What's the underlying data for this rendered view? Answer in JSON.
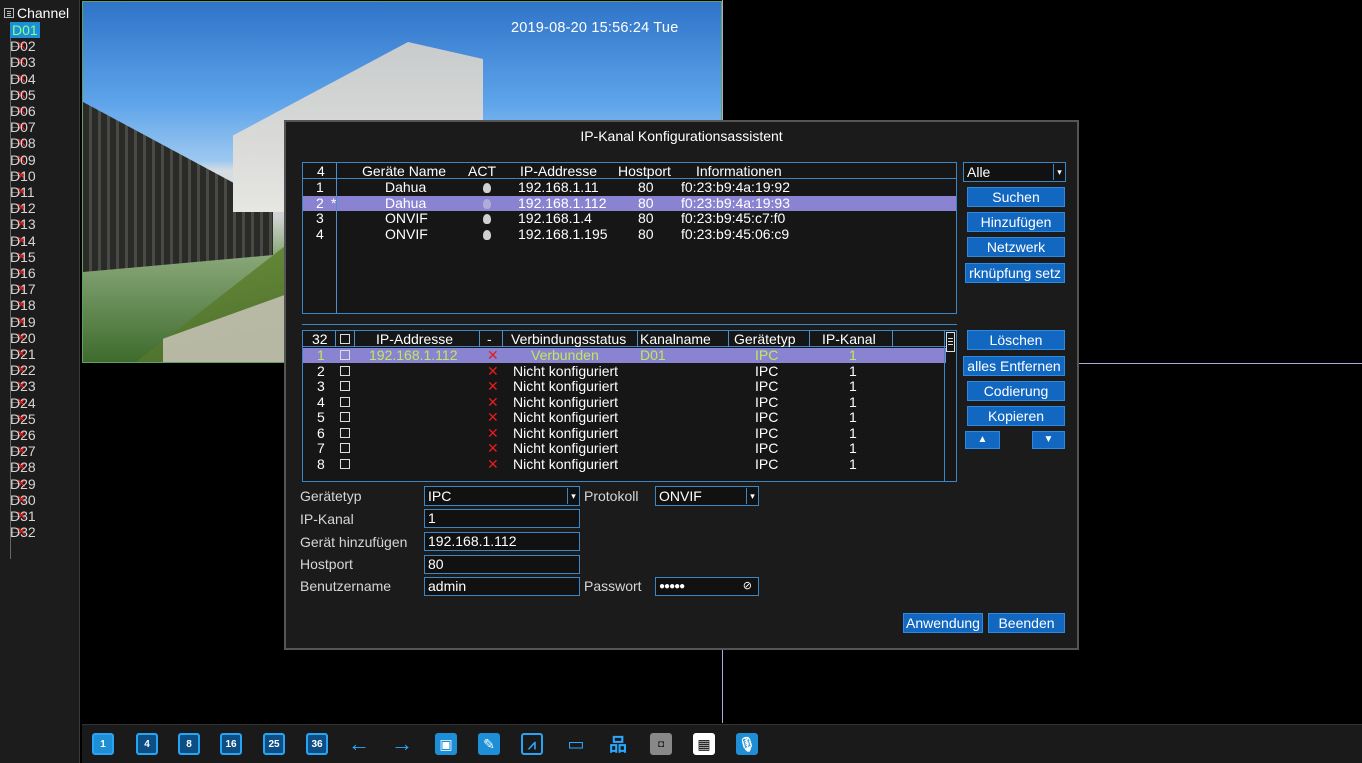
{
  "sidebar": {
    "root_label": "Channel",
    "channels": [
      "D01",
      "D02",
      "D03",
      "D04",
      "D05",
      "D06",
      "D07",
      "D08",
      "D09",
      "D10",
      "D11",
      "D12",
      "D13",
      "D14",
      "D15",
      "D16",
      "D17",
      "D18",
      "D19",
      "D20",
      "D21",
      "D22",
      "D23",
      "D24",
      "D25",
      "D26",
      "D27",
      "D28",
      "D29",
      "D30",
      "D31",
      "D32"
    ],
    "selected": "D01"
  },
  "camera": {
    "timestamp": "2019-08-20 15:56:24 Tue"
  },
  "dialog": {
    "title": "IP-Kanal Konfigurationsassistent",
    "search_table": {
      "count": "4",
      "headers": [
        "Geräte Name",
        "ACT",
        "IP-Addresse",
        "Hostport",
        "Informationen"
      ],
      "rows": [
        {
          "no": "1",
          "mark": "",
          "name": "Dahua",
          "ip": "192.168.1.11",
          "port": "80",
          "info": "f0:23:b9:4a:19:92"
        },
        {
          "no": "2",
          "mark": "*",
          "name": "Dahua",
          "ip": "192.168.1.112",
          "port": "80",
          "info": "f0:23:b9:4a:19:93"
        },
        {
          "no": "3",
          "mark": "",
          "name": "ONVIF",
          "ip": "192.168.1.4",
          "port": "80",
          "info": "f0:23:b9:45:c7:f0"
        },
        {
          "no": "4",
          "mark": "",
          "name": "ONVIF",
          "ip": "192.168.1.195",
          "port": "80",
          "info": "f0:23:b9:45:06:c9"
        }
      ]
    },
    "filter": {
      "value": "Alle"
    },
    "buttons_top": {
      "suchen": "Suchen",
      "hinzufuegen": "Hinzufügen",
      "netzwerk": "Netzwerk",
      "verknuepfung": "rknüpfung setz"
    },
    "channel_table": {
      "count": "32",
      "headers": [
        "IP-Addresse",
        "-",
        "Verbindungsstatus",
        "Kanalname",
        "Gerätetyp",
        "IP-Kanal"
      ],
      "rows": [
        {
          "no": "1",
          "ip": "192.168.1.112",
          "status": "Verbunden",
          "name": "D01",
          "type": "IPC",
          "ch": "1"
        },
        {
          "no": "2",
          "ip": "",
          "status": "Nicht konfiguriert",
          "name": "",
          "type": "IPC",
          "ch": "1"
        },
        {
          "no": "3",
          "ip": "",
          "status": "Nicht konfiguriert",
          "name": "",
          "type": "IPC",
          "ch": "1"
        },
        {
          "no": "4",
          "ip": "",
          "status": "Nicht konfiguriert",
          "name": "",
          "type": "IPC",
          "ch": "1"
        },
        {
          "no": "5",
          "ip": "",
          "status": "Nicht konfiguriert",
          "name": "",
          "type": "IPC",
          "ch": "1"
        },
        {
          "no": "6",
          "ip": "",
          "status": "Nicht konfiguriert",
          "name": "",
          "type": "IPC",
          "ch": "1"
        },
        {
          "no": "7",
          "ip": "",
          "status": "Nicht konfiguriert",
          "name": "",
          "type": "IPC",
          "ch": "1"
        },
        {
          "no": "8",
          "ip": "",
          "status": "Nicht konfiguriert",
          "name": "",
          "type": "IPC",
          "ch": "1"
        }
      ]
    },
    "buttons_mid": {
      "loeschen": "Löschen",
      "alles_entfernen": "alles Entfernen",
      "codierung": "Codierung",
      "kopieren": "Kopieren"
    },
    "form": {
      "geraetetyp_label": "Gerätetyp",
      "geraetetyp_value": "IPC",
      "protokoll_label": "Protokoll",
      "protokoll_value": "ONVIF",
      "ipkanal_label": "IP-Kanal",
      "ipkanal_value": "1",
      "geraet_label": "Gerät hinzufügen",
      "geraet_value": "192.168.1.112",
      "hostport_label": "Hostport",
      "hostport_value": "80",
      "benutzer_label": "Benutzername",
      "benutzer_value": "admin",
      "passwort_label": "Passwort",
      "passwort_value": "●●●●●"
    },
    "buttons_bottom": {
      "anwendung": "Anwendung",
      "beenden": "Beenden"
    }
  },
  "toolbar": {
    "layout_1": "1",
    "layout_4": "4",
    "layout_8": "8",
    "layout_16": "16",
    "layout_25": "25",
    "layout_36": "36"
  }
}
